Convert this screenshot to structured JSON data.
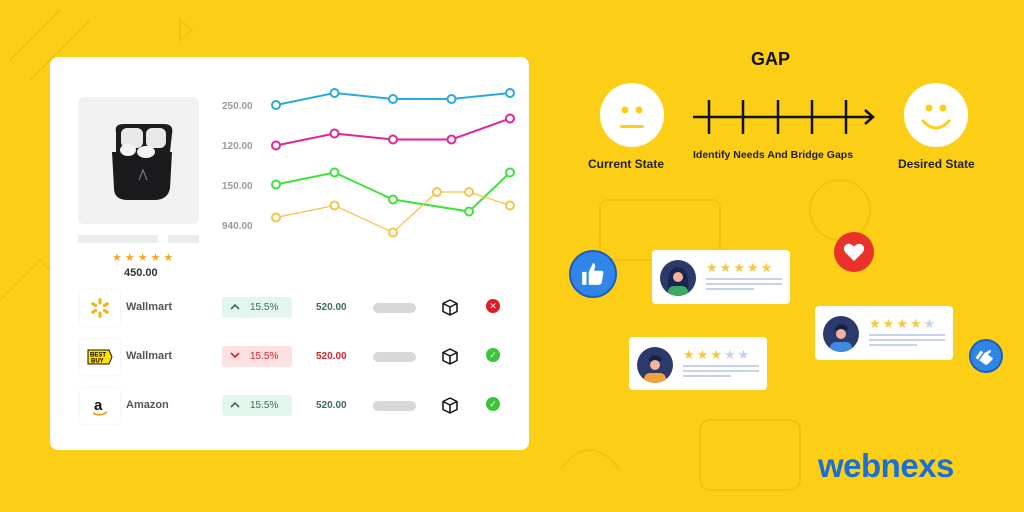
{
  "product": {
    "price": "450.00",
    "rating": 5,
    "star_color": "#f7a823"
  },
  "chart_data": {
    "type": "line",
    "y_tick_labels": [
      "250.00",
      "120.00",
      "150.00",
      "940.00"
    ],
    "note": "Decorative line chart; values estimated in arbitrary relative units (higher = higher on chart, 0-100 scale).",
    "series": [
      {
        "name": "blue",
        "color": "#2aa8e0",
        "x": [
          0,
          1,
          2,
          3,
          4
        ],
        "values": [
          88,
          96,
          92,
          92,
          96
        ]
      },
      {
        "name": "pink",
        "color": "#e0259a",
        "x": [
          0,
          1,
          2,
          3,
          4
        ],
        "values": [
          61,
          69,
          65,
          65,
          79
        ]
      },
      {
        "name": "green",
        "color": "#3fe23a",
        "x": [
          0,
          1,
          2,
          3.3,
          4
        ],
        "values": [
          35,
          43,
          25,
          17,
          43
        ]
      },
      {
        "name": "yellow",
        "color": "#f6c344",
        "x": [
          0,
          1,
          2,
          2.75,
          3.3,
          4
        ],
        "values": [
          13,
          21,
          3,
          30,
          30,
          21
        ]
      }
    ],
    "xlim": [
      0,
      4
    ],
    "ylim": [
      0,
      100
    ]
  },
  "stores": [
    {
      "name": "Wallmart",
      "logo": "walmart-logo",
      "trend": "up",
      "change": "15.5%",
      "amount": "520.00",
      "status": "error"
    },
    {
      "name": "Wallmart",
      "logo": "bestbuy-logo",
      "trend": "down",
      "change": "15.5%",
      "amount": "520.00",
      "status": "ok"
    },
    {
      "name": "Amazon",
      "logo": "amazon-logo",
      "trend": "up",
      "change": "15.5%",
      "amount": "520.00",
      "status": "ok"
    }
  ],
  "gap": {
    "title": "GAP",
    "current_label": "Current State",
    "middle_label": "Identify Needs And Bridge Gaps",
    "desired_label": "Desired State"
  },
  "reviews": [
    {
      "stars": 5,
      "avatar": "woman-green"
    },
    {
      "stars": 4,
      "avatar": "man-blue"
    },
    {
      "stars": 3,
      "avatar": "man-orange"
    }
  ],
  "colors": {
    "background": "#fccf16",
    "brand": "#1a6fd6",
    "up": "#3d6b5a",
    "down": "#d9222a"
  },
  "brand": {
    "name": "webnexs"
  }
}
